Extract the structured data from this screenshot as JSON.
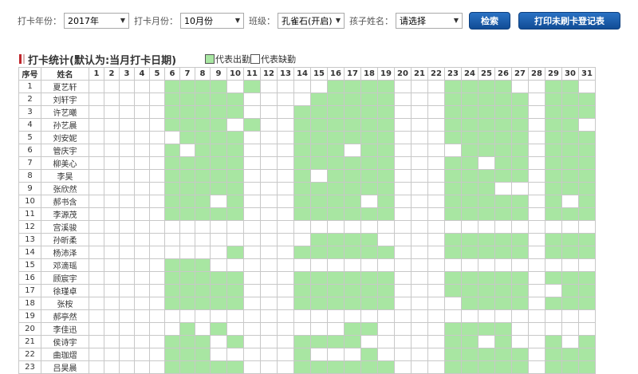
{
  "filters": {
    "year_label": "打卡年份：",
    "year_value": "2017年",
    "month_label": "打卡月份：",
    "month_value": "10月份",
    "class_label": "班级：",
    "class_value": "孔雀石(开启)",
    "child_label": "孩子姓名：",
    "child_value": "请选择",
    "search_button": "检索",
    "print_button": "打印未刷卡登记表"
  },
  "section": {
    "title": "打卡统计(默认为:当月打卡日期)",
    "legend_present": "代表出勤",
    "legend_absent": "代表缺勤"
  },
  "colors": {
    "present": "#a8e6a2",
    "absent": "#ffffff",
    "accent": "#c0262c",
    "button": "#1a5ca8"
  },
  "table": {
    "col_seq": "序号",
    "col_name": "姓名",
    "days": [
      "1",
      "2",
      "3",
      "4",
      "5",
      "6",
      "7",
      "8",
      "9",
      "10",
      "11",
      "12",
      "13",
      "14",
      "15",
      "16",
      "17",
      "18",
      "19",
      "20",
      "21",
      "22",
      "23",
      "24",
      "25",
      "26",
      "27",
      "28",
      "29",
      "30",
      "31"
    ],
    "rows": [
      {
        "seq": "1",
        "name": "夏艺轩",
        "att": "0000000011110100001111000111100110"
      },
      {
        "seq": "2",
        "name": "刘轩宇",
        "att": "0000000011111000011111000111110111"
      },
      {
        "seq": "3",
        "name": "许艺曦",
        "att": "0000000011111000111111000111110111"
      },
      {
        "seq": "4",
        "name": "孙艺晨",
        "att": "0000000011110100111111000111110110"
      },
      {
        "seq": "5",
        "name": "刘安妮",
        "att": "0000000001111000111111000111110111"
      },
      {
        "seq": "6",
        "name": "管庆宇",
        "att": "0000000010111000111011000011110111"
      },
      {
        "seq": "7",
        "name": "柳美心",
        "att": "0000000011111000111111000110110111"
      },
      {
        "seq": "8",
        "name": "李昊",
        "att": "0000000011111000101111000111110111"
      },
      {
        "seq": "9",
        "name": "张欣然",
        "att": "0000000011111000111111000111000111"
      },
      {
        "seq": "10",
        "name": "郝书含",
        "att": "0000000011101000111101000111110101"
      },
      {
        "seq": "11",
        "name": "李源茂",
        "att": "0000000011111000111111000111110111"
      },
      {
        "seq": "12",
        "name": "宫溪骏",
        "att": "0000000000000000000000000000000000"
      },
      {
        "seq": "13",
        "name": "孙昕柔",
        "att": "0000000000000000011110000111110111"
      },
      {
        "seq": "14",
        "name": "杨沛泽",
        "att": "0000000000001000111111000111110111"
      },
      {
        "seq": "15",
        "name": "邓滴瑶",
        "att": "0000000011100000000000000000000000"
      },
      {
        "seq": "16",
        "name": "顾宸宇",
        "att": "0000000011111000111111000111110111"
      },
      {
        "seq": "17",
        "name": "徐瑾卓",
        "att": "0000000011111000111111000111110011"
      },
      {
        "seq": "18",
        "name": "张桉",
        "att": "0000000011111000111111000011110111"
      },
      {
        "seq": "19",
        "name": "郝亭然",
        "att": "0000000000000000000000000000000000"
      },
      {
        "seq": "20",
        "name": "李佳迅",
        "att": "0000000001010000000110000111100000"
      },
      {
        "seq": "21",
        "name": "侯诗宇",
        "att": "0000000011101000111100000110100101"
      },
      {
        "seq": "22",
        "name": "曲珈熠",
        "att": "0000000011100000100010000111110111"
      },
      {
        "seq": "23",
        "name": "吕昊晨",
        "att": "0000000011111000111111000111110111"
      }
    ]
  }
}
